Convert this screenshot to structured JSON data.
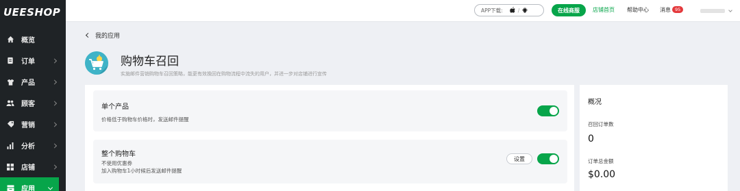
{
  "brand": {
    "logo_text": "UEESHOP"
  },
  "sidebar": {
    "items": [
      {
        "label": "概览",
        "icon": "home-icon",
        "has_chevron": false
      },
      {
        "label": "订单",
        "icon": "order-icon",
        "has_chevron": true
      },
      {
        "label": "产品",
        "icon": "product-icon",
        "has_chevron": true
      },
      {
        "label": "顾客",
        "icon": "customers-icon",
        "has_chevron": true
      },
      {
        "label": "营销",
        "icon": "tag-icon",
        "has_chevron": true
      },
      {
        "label": "分析",
        "icon": "bar-chart-icon",
        "has_chevron": true
      },
      {
        "label": "店铺",
        "icon": "store-grid-icon",
        "has_chevron": true
      },
      {
        "label": "应用",
        "icon": "app-icon",
        "has_chevron": true,
        "active": true
      }
    ]
  },
  "topbar": {
    "app_download_label": "APP下载:",
    "app_divider": "/",
    "online_store_button": "在线商服",
    "shop_home_link": "店铺首页",
    "help_center_link": "帮助中心",
    "messages_link": "消息",
    "messages_count": "95"
  },
  "breadcrumb": {
    "back_label": "我的应用"
  },
  "page": {
    "title": "购物车召回",
    "description": "实施邮件营销购物车召回策略，能更有效挽回在购物流程中流失的用户，并进一步对店铺进行宣传"
  },
  "settings": [
    {
      "title": "单个产品",
      "desc_lines": [
        "价格低于购物车价格时，发送邮件提醒"
      ],
      "enabled": true,
      "has_settings_button": false
    },
    {
      "title": "整个购物车",
      "desc_lines": [
        "不使用优惠券",
        "加入购物车1小时候后发送邮件提醒"
      ],
      "enabled": true,
      "has_settings_button": true,
      "settings_button_label": "设置"
    }
  ],
  "overview": {
    "title": "概况",
    "stats": [
      {
        "label": "召回订单数",
        "value": "0"
      },
      {
        "label": "订单总金额",
        "value": "$0.00"
      }
    ]
  },
  "colors": {
    "accent": "#07a54a",
    "sidebar_bg": "#1f2326",
    "badge": "#e4393c",
    "hero_icon_bg": "#3fb3c7"
  }
}
